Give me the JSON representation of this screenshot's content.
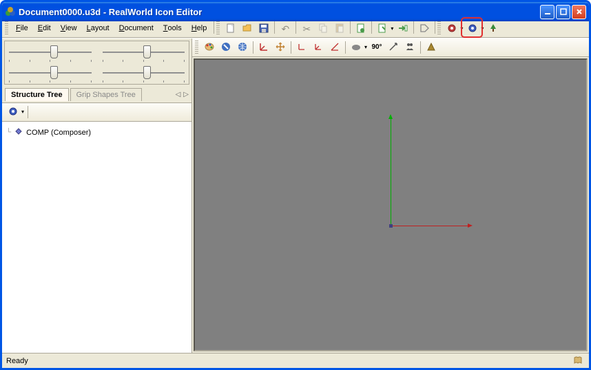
{
  "window": {
    "title": "Document0000.u3d - RealWorld Icon Editor"
  },
  "menu": {
    "file": "File",
    "edit": "Edit",
    "view": "View",
    "layout": "Layout",
    "document": "Document",
    "tools": "Tools",
    "help": "Help"
  },
  "sidebar": {
    "tabs": {
      "structure": "Structure Tree",
      "grip": "Grip Shapes Tree"
    },
    "tree": {
      "root": "COMP (Composer)"
    }
  },
  "status": {
    "text": "Ready"
  },
  "icons": {
    "new": "new-doc",
    "open": "open-folder",
    "save": "save-disk"
  }
}
